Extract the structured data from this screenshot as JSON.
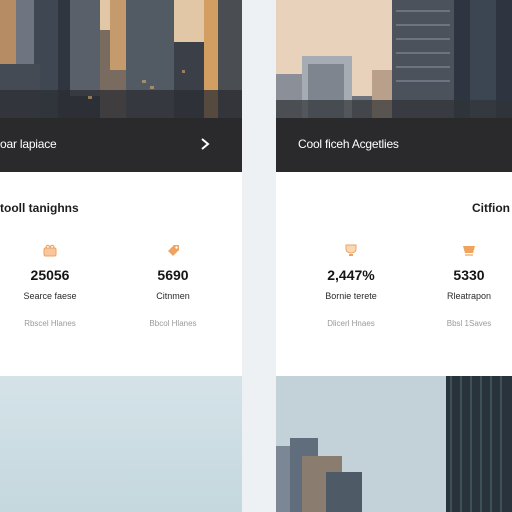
{
  "left_panel": {
    "title": "oar lapiace",
    "card_title": "tooll tanighns",
    "stats": [
      {
        "icon": "gift-icon",
        "value": "25056",
        "label": "Searce faese",
        "sub": "Rbscel Hlanes"
      },
      {
        "icon": "tag-icon",
        "value": "5690",
        "label": "Citnmen",
        "sub": "Bbcol Hlanes"
      }
    ]
  },
  "right_panel": {
    "title": "Cool ficeh Acgetlies",
    "card_title": "Citfion",
    "stats": [
      {
        "icon": "trophy-icon",
        "value": "2,447%",
        "label": "Bornie terete",
        "sub": "Dlicerl Hnaes"
      },
      {
        "icon": "cart-icon",
        "value": "5330",
        "label": "Rleatrapon",
        "sub": "Bbsl 1Saves"
      }
    ]
  },
  "colors": {
    "title_bar": "#2a2a2c",
    "accent_icon": "#f0a25f",
    "card_bg": "#ffffff",
    "page_bg": "#eef1f4"
  }
}
